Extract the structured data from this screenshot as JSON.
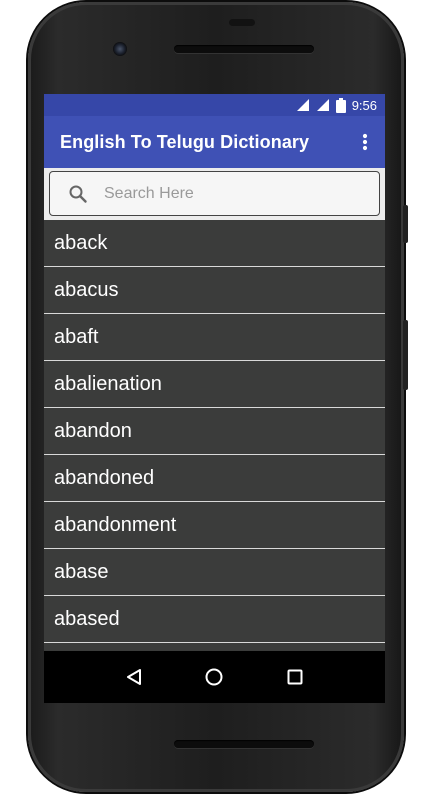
{
  "status_bar": {
    "time": "9:56",
    "icons": [
      "signal-icon",
      "signal-icon",
      "battery-icon"
    ]
  },
  "app_bar": {
    "title": "English To Telugu Dictionary",
    "menu_icon": "more-vert-icon"
  },
  "search": {
    "placeholder": "Search Here",
    "value": "",
    "icon": "search-icon"
  },
  "words": [
    "aback",
    "abacus",
    "abaft",
    "abalienation",
    "abandon",
    "abandoned",
    "abandonment",
    "abase",
    "abased"
  ],
  "nav_bar": {
    "buttons": [
      "back-icon",
      "home-icon",
      "recents-icon"
    ]
  },
  "colors": {
    "status_bar": "#3647a8",
    "app_bar": "#3f51b5",
    "list_background": "#3b3c3b",
    "list_divider": "#d9d9d9"
  }
}
